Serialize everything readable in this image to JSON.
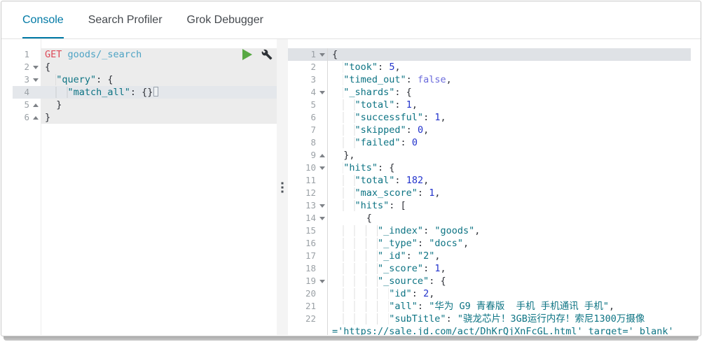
{
  "app": "Kibana Dev Tools",
  "tabs": [
    {
      "label": "Console",
      "active": true
    },
    {
      "label": "Search Profiler",
      "active": false
    },
    {
      "label": "Grok Debugger",
      "active": false
    }
  ],
  "colors": {
    "accent": "#0079a5",
    "method": "#dd4a58",
    "url": "#4da3c4",
    "string": "#0c7383",
    "number": "#2233cc",
    "boolean": "#6b6bdc",
    "play": "#57a843"
  },
  "request_editor": {
    "actions": [
      {
        "name": "send-request-button",
        "icon": "play-icon"
      },
      {
        "name": "request-options-button",
        "icon": "wrench-icon"
      }
    ],
    "lines": [
      {
        "n": "1",
        "fold": "",
        "code": "req",
        "tokens": [
          [
            "method",
            "GET"
          ],
          [
            "plain",
            " "
          ],
          [
            "url",
            "goods/_search"
          ]
        ]
      },
      {
        "n": "2",
        "fold": "d",
        "code": "req",
        "tokens": [
          [
            "plain",
            "{"
          ]
        ]
      },
      {
        "n": "3",
        "fold": "d",
        "code": "req",
        "tokens": [
          [
            "plain",
            "  "
          ],
          [
            "str",
            "\"query\""
          ],
          [
            "plain",
            ": {"
          ]
        ]
      },
      {
        "n": "4",
        "fold": "",
        "row": "active-req",
        "code": "req",
        "cursor": true,
        "tokens": [
          [
            "plain",
            "    "
          ],
          [
            "str",
            "\"match_all\""
          ],
          [
            "plain",
            ": {}"
          ]
        ]
      },
      {
        "n": "5",
        "fold": "u",
        "code": "req",
        "tokens": [
          [
            "plain",
            "  }"
          ]
        ]
      },
      {
        "n": "6",
        "fold": "u",
        "code": "req",
        "tokens": [
          [
            "plain",
            "}"
          ]
        ]
      }
    ]
  },
  "response_editor": {
    "lines": [
      {
        "n": "1",
        "fold": "d",
        "row": "active-res",
        "tokens": [
          [
            "plain",
            "{"
          ]
        ]
      },
      {
        "n": "2",
        "fold": "",
        "tokens": [
          [
            "plain",
            "  "
          ],
          [
            "str",
            "\"took\""
          ],
          [
            "plain",
            ": "
          ],
          [
            "num",
            "5"
          ],
          [
            "plain",
            ","
          ]
        ]
      },
      {
        "n": "3",
        "fold": "",
        "tokens": [
          [
            "plain",
            "  "
          ],
          [
            "str",
            "\"timed_out\""
          ],
          [
            "plain",
            ": "
          ],
          [
            "bool",
            "false"
          ],
          [
            "plain",
            ","
          ]
        ]
      },
      {
        "n": "4",
        "fold": "d",
        "tokens": [
          [
            "plain",
            "  "
          ],
          [
            "str",
            "\"_shards\""
          ],
          [
            "plain",
            ": {"
          ]
        ]
      },
      {
        "n": "5",
        "fold": "",
        "tokens": [
          [
            "plain",
            "    "
          ],
          [
            "str",
            "\"total\""
          ],
          [
            "plain",
            ": "
          ],
          [
            "num",
            "1"
          ],
          [
            "plain",
            ","
          ]
        ]
      },
      {
        "n": "6",
        "fold": "",
        "tokens": [
          [
            "plain",
            "    "
          ],
          [
            "str",
            "\"successful\""
          ],
          [
            "plain",
            ": "
          ],
          [
            "num",
            "1"
          ],
          [
            "plain",
            ","
          ]
        ]
      },
      {
        "n": "7",
        "fold": "",
        "tokens": [
          [
            "plain",
            "    "
          ],
          [
            "str",
            "\"skipped\""
          ],
          [
            "plain",
            ": "
          ],
          [
            "num",
            "0"
          ],
          [
            "plain",
            ","
          ]
        ]
      },
      {
        "n": "8",
        "fold": "",
        "tokens": [
          [
            "plain",
            "    "
          ],
          [
            "str",
            "\"failed\""
          ],
          [
            "plain",
            ": "
          ],
          [
            "num",
            "0"
          ]
        ]
      },
      {
        "n": "9",
        "fold": "u",
        "tokens": [
          [
            "plain",
            "  },"
          ]
        ]
      },
      {
        "n": "10",
        "fold": "d",
        "tokens": [
          [
            "plain",
            "  "
          ],
          [
            "str",
            "\"hits\""
          ],
          [
            "plain",
            ": {"
          ]
        ]
      },
      {
        "n": "11",
        "fold": "",
        "tokens": [
          [
            "plain",
            "    "
          ],
          [
            "str",
            "\"total\""
          ],
          [
            "plain",
            ": "
          ],
          [
            "num",
            "182"
          ],
          [
            "plain",
            ","
          ]
        ]
      },
      {
        "n": "12",
        "fold": "",
        "tokens": [
          [
            "plain",
            "    "
          ],
          [
            "str",
            "\"max_score\""
          ],
          [
            "plain",
            ": "
          ],
          [
            "num",
            "1"
          ],
          [
            "plain",
            ","
          ]
        ]
      },
      {
        "n": "13",
        "fold": "d",
        "tokens": [
          [
            "plain",
            "    "
          ],
          [
            "str",
            "\"hits\""
          ],
          [
            "plain",
            ": ["
          ]
        ]
      },
      {
        "n": "14",
        "fold": "d",
        "tokens": [
          [
            "plain",
            "      {"
          ]
        ]
      },
      {
        "n": "15",
        "fold": "",
        "tokens": [
          [
            "plain",
            "        "
          ],
          [
            "str",
            "\"_index\""
          ],
          [
            "plain",
            ": "
          ],
          [
            "str",
            "\"goods\""
          ],
          [
            "plain",
            ","
          ]
        ]
      },
      {
        "n": "16",
        "fold": "",
        "tokens": [
          [
            "plain",
            "        "
          ],
          [
            "str",
            "\"_type\""
          ],
          [
            "plain",
            ": "
          ],
          [
            "str",
            "\"docs\""
          ],
          [
            "plain",
            ","
          ]
        ]
      },
      {
        "n": "17",
        "fold": "",
        "tokens": [
          [
            "plain",
            "        "
          ],
          [
            "str",
            "\"_id\""
          ],
          [
            "plain",
            ": "
          ],
          [
            "str",
            "\"2\""
          ],
          [
            "plain",
            ","
          ]
        ]
      },
      {
        "n": "18",
        "fold": "",
        "tokens": [
          [
            "plain",
            "        "
          ],
          [
            "str",
            "\"_score\""
          ],
          [
            "plain",
            ": "
          ],
          [
            "num",
            "1"
          ],
          [
            "plain",
            ","
          ]
        ]
      },
      {
        "n": "19",
        "fold": "d",
        "tokens": [
          [
            "plain",
            "        "
          ],
          [
            "str",
            "\"_source\""
          ],
          [
            "plain",
            ": {"
          ]
        ]
      },
      {
        "n": "20",
        "fold": "",
        "tokens": [
          [
            "plain",
            "          "
          ],
          [
            "str",
            "\"id\""
          ],
          [
            "plain",
            ": "
          ],
          [
            "num",
            "2"
          ],
          [
            "plain",
            ","
          ]
        ]
      },
      {
        "n": "21",
        "fold": "",
        "tokens": [
          [
            "plain",
            "          "
          ],
          [
            "str",
            "\"all\""
          ],
          [
            "plain",
            ": "
          ],
          [
            "str",
            "\"华为 G9 青春版  手机 手机通讯 手机\""
          ],
          [
            "plain",
            ","
          ]
        ]
      },
      {
        "n": "22",
        "fold": "",
        "tokens": [
          [
            "plain",
            "          "
          ],
          [
            "str",
            "\"subTitle\""
          ],
          [
            "plain",
            ": "
          ],
          [
            "str",
            "\"骁龙芯片！3GB运行内存！索尼1300万摄像"
          ]
        ]
      },
      {
        "n": "",
        "fold": "",
        "tokens": [
          [
            "str",
            "='https://sale.jd.com/act/DhKrQjXnFcGL.html' target='_blank'"
          ]
        ]
      }
    ]
  }
}
